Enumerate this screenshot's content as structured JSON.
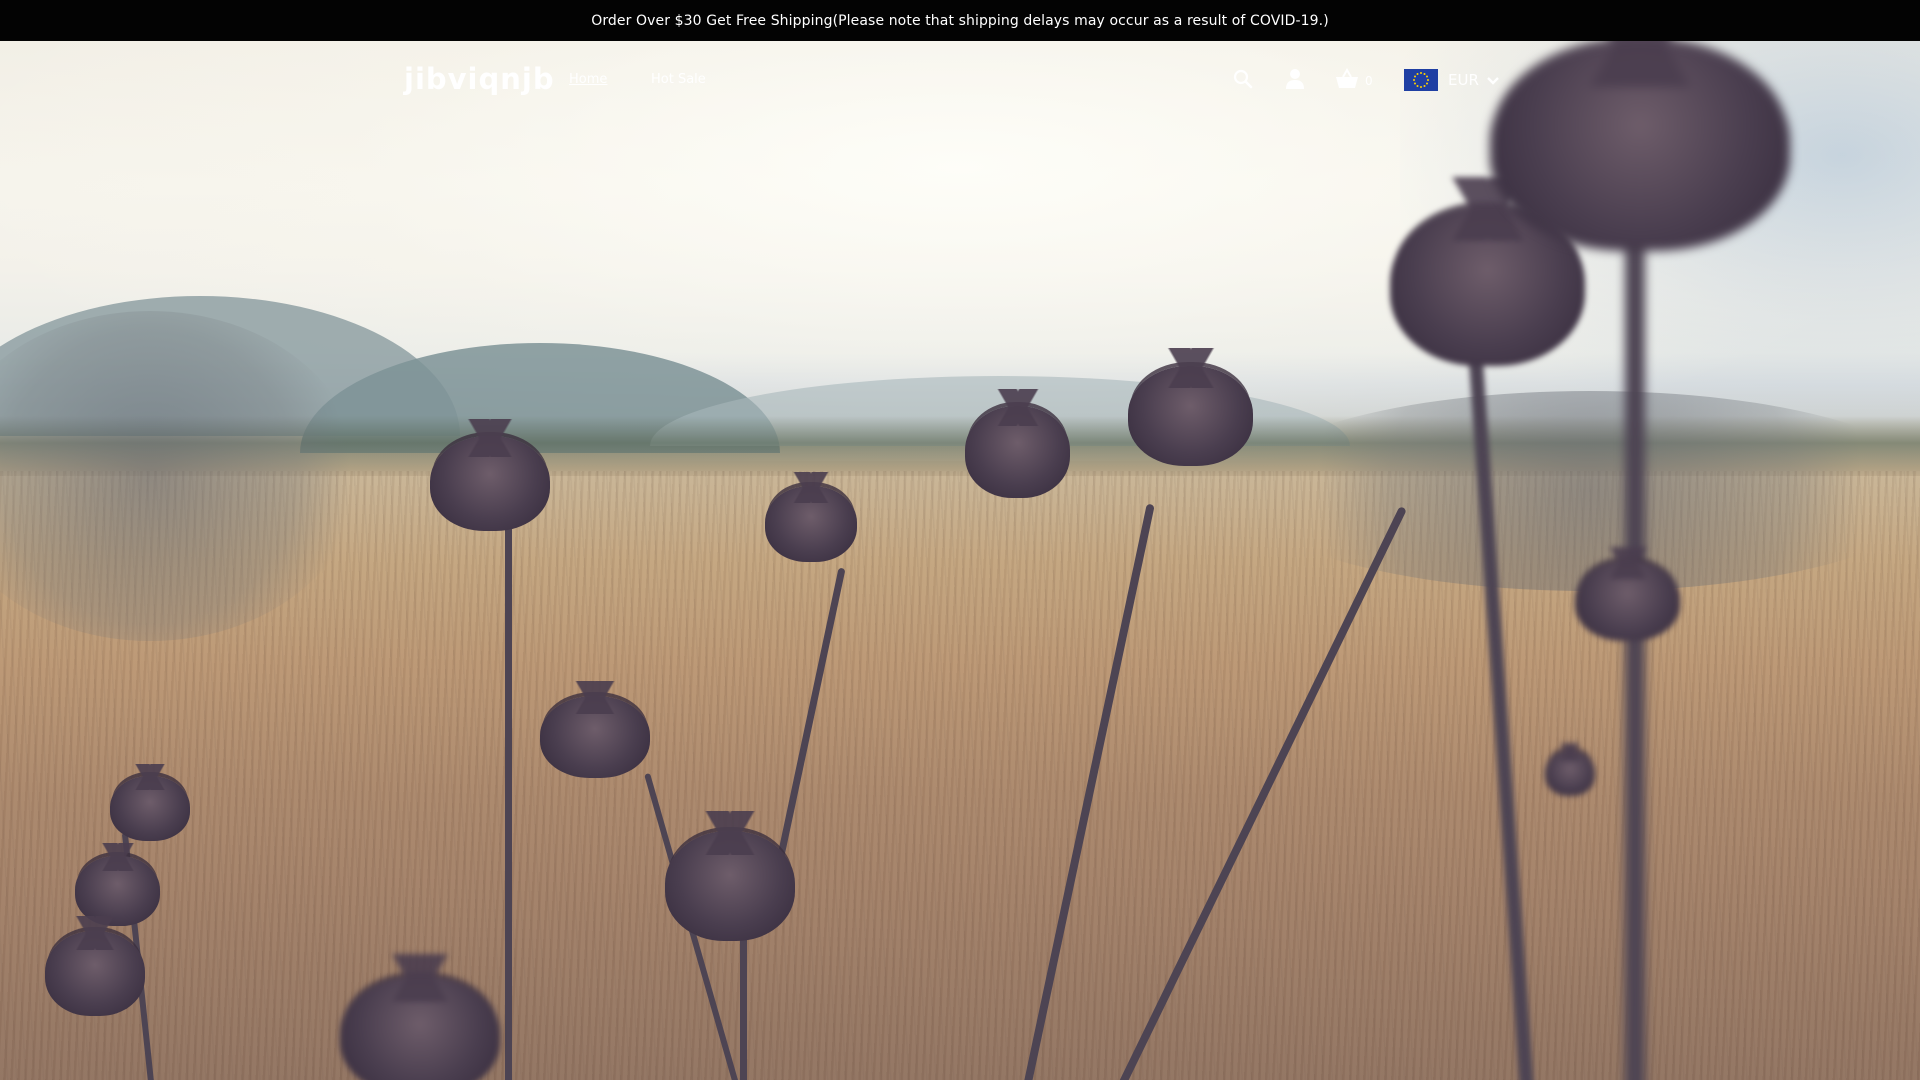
{
  "announcement": {
    "text": "Order Over $30 Get Free Shipping(Please note that shipping delays may occur as a result of COVID-19.)"
  },
  "header": {
    "logo": "jibviqnjb",
    "nav": [
      {
        "label": "Home",
        "active": true
      },
      {
        "label": "Hot Sale",
        "active": false
      }
    ],
    "icons": {
      "search": "search-icon",
      "account": "user-icon",
      "cart": "shopping-basket-icon"
    },
    "cart_count": "0",
    "currency": {
      "flag": "eu-flag-icon",
      "code": "EUR"
    }
  },
  "hero": {
    "image": "landscape with dried thistle flowers"
  },
  "colors": {
    "announcement_bg": "#030303",
    "announcement_text": "#ffffff",
    "header_text": "#ffffff",
    "flag_blue": "#1f3fa3",
    "flag_stars": "#ffd200"
  }
}
